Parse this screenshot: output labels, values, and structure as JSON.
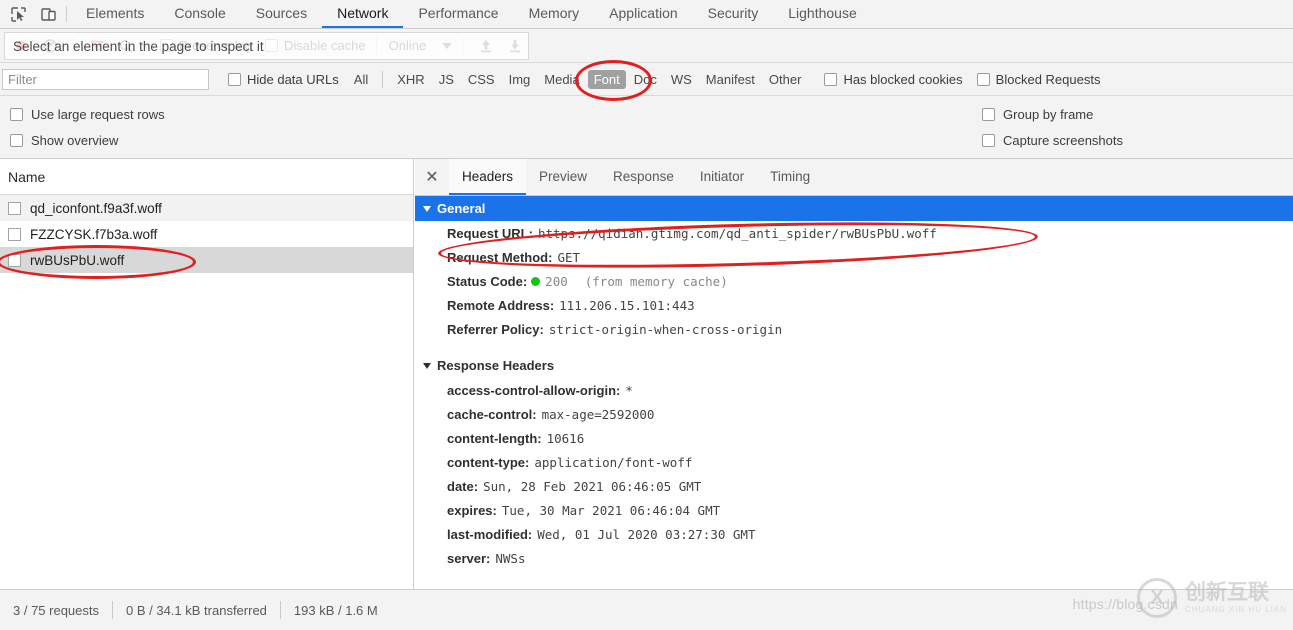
{
  "devtools": {
    "left_icons": [
      {
        "name": "inspect-element-icon",
        "glyph": "inspect"
      },
      {
        "name": "device-toolbar-icon",
        "glyph": "device"
      }
    ],
    "tabs": [
      {
        "label": "Elements",
        "active": false
      },
      {
        "label": "Console",
        "active": false
      },
      {
        "label": "Sources",
        "active": false
      },
      {
        "label": "Network",
        "active": true
      },
      {
        "label": "Performance",
        "active": false
      },
      {
        "label": "Memory",
        "active": false
      },
      {
        "label": "Application",
        "active": false
      },
      {
        "label": "Security",
        "active": false
      },
      {
        "label": "Lighthouse",
        "active": false
      }
    ]
  },
  "network_toolbar": {
    "record_icon": "record-circle-icon",
    "clear_icon": "clear-icon",
    "filter_icon": "filter-funnel-icon",
    "search_icon": "search-icon",
    "preserve_log_label": "Preserve log",
    "disable_cache_label": "Disable cache",
    "throttle_value": "Online",
    "import_icon": "import-har-icon",
    "export_icon": "export-har-icon",
    "tooltip": "Select an element in the page to inspect it"
  },
  "filter_bar": {
    "filter_placeholder": "Filter",
    "filter_value": "",
    "hide_data_urls_label": "Hide data URLs",
    "types": [
      {
        "label": "All",
        "selected": false
      },
      {
        "label": "XHR",
        "selected": false
      },
      {
        "label": "JS",
        "selected": false
      },
      {
        "label": "CSS",
        "selected": false
      },
      {
        "label": "Img",
        "selected": false
      },
      {
        "label": "Media",
        "selected": false
      },
      {
        "label": "Font",
        "selected": true
      },
      {
        "label": "Doc",
        "selected": false
      },
      {
        "label": "WS",
        "selected": false
      },
      {
        "label": "Manifest",
        "selected": false
      },
      {
        "label": "Other",
        "selected": false
      }
    ],
    "has_blocked_cookies_label": "Has blocked cookies",
    "blocked_requests_label": "Blocked Requests"
  },
  "settings_panel": {
    "left": [
      {
        "label": "Use large request rows",
        "checked": false
      },
      {
        "label": "Show overview",
        "checked": false
      }
    ],
    "right": [
      {
        "label": "Group by frame",
        "checked": false
      },
      {
        "label": "Capture screenshots",
        "checked": false
      }
    ]
  },
  "request_list": {
    "column_header": "Name",
    "rows": [
      {
        "name": "qd_iconfont.f9a3f.woff",
        "selected": false
      },
      {
        "name": "FZZCYSK.f7b3a.woff",
        "selected": false
      },
      {
        "name": "rwBUsPbU.woff",
        "selected": true
      }
    ]
  },
  "detail_panel": {
    "close_icon": "close-icon",
    "tabs": [
      {
        "label": "Headers",
        "active": true
      },
      {
        "label": "Preview",
        "active": false
      },
      {
        "label": "Response",
        "active": false
      },
      {
        "label": "Initiator",
        "active": false
      },
      {
        "label": "Timing",
        "active": false
      }
    ],
    "general": {
      "section_title": "General",
      "rows": [
        {
          "key": "Request URL:",
          "value": "https://qidian.gtimg.com/qd_anti_spider/rwBUsPbU.woff"
        },
        {
          "key": "Request Method:",
          "value": "GET"
        },
        {
          "key": "Status Code:",
          "value": "200",
          "extra": "(from memory cache)",
          "status_color": "#17c217"
        },
        {
          "key": "Remote Address:",
          "value": "111.206.15.101:443"
        },
        {
          "key": "Referrer Policy:",
          "value": "strict-origin-when-cross-origin"
        }
      ]
    },
    "response_headers": {
      "section_title": "Response Headers",
      "rows": [
        {
          "key": "access-control-allow-origin:",
          "value": "*"
        },
        {
          "key": "cache-control:",
          "value": "max-age=2592000"
        },
        {
          "key": "content-length:",
          "value": "10616"
        },
        {
          "key": "content-type:",
          "value": "application/font-woff"
        },
        {
          "key": "date:",
          "value": "Sun, 28 Feb 2021 06:46:05 GMT"
        },
        {
          "key": "expires:",
          "value": "Tue, 30 Mar 2021 06:46:04 GMT"
        },
        {
          "key": "last-modified:",
          "value": "Wed, 01 Jul 2020 03:27:30 GMT"
        },
        {
          "key": "server:",
          "value": "NWSs"
        }
      ]
    }
  },
  "status_bar": {
    "requests": "3 / 75 requests",
    "transferred": "0 B / 34.1 kB transferred",
    "resources": "193 kB / 1.6 M"
  },
  "watermark": {
    "url": "https://blog.csdn",
    "brand_cn": "创新互联",
    "brand_pinyin": "CHUANG XIN HU LIAN",
    "logo_glyph": "X"
  },
  "annotations": {
    "accent_color": "#e02020",
    "ellipses": [
      "font-filter-highlight",
      "selected-request-highlight",
      "request-url-highlight"
    ]
  }
}
